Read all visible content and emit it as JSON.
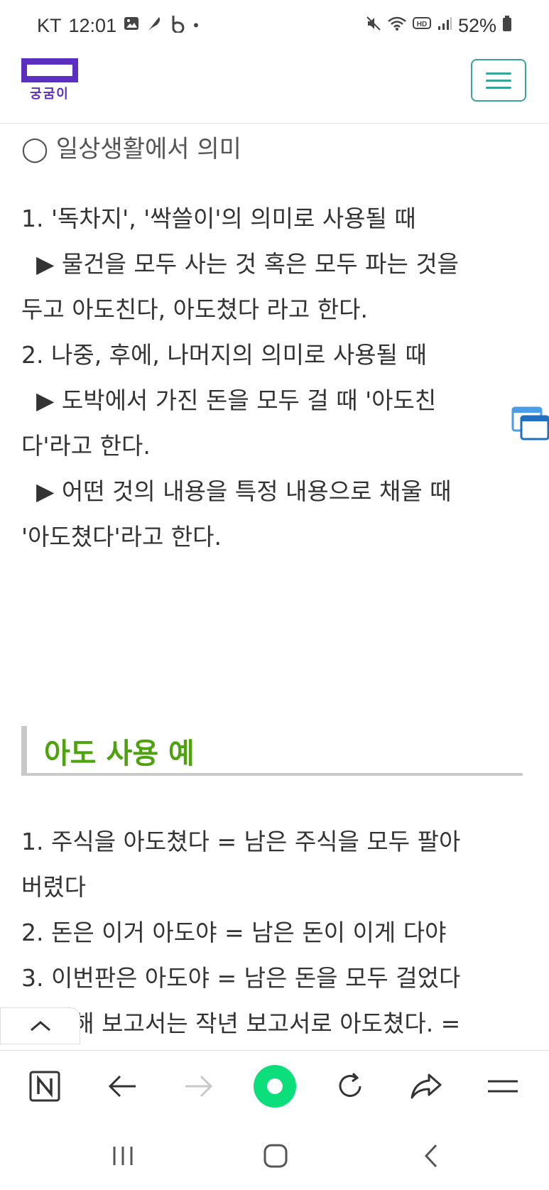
{
  "status_bar": {
    "carrier": "KT",
    "time": "12:01",
    "battery": "52%",
    "icons_left": [
      "gallery-icon",
      "feather-icon",
      "b-icon",
      "dot-icon"
    ],
    "icons_right": [
      "mute-icon",
      "wifi-icon",
      "hd-icon",
      "signal-icon",
      "battery-icon"
    ]
  },
  "header": {
    "logo_text": "궁굼이",
    "brand_color": "#5b2fc0",
    "menu_color": "#3aa39a"
  },
  "article": {
    "section_title": "◯ 일상생활에서 의미",
    "lines": [
      "1. '독차지', '싹쓸이'의 의미로 사용될 때",
      "  ▶ 물건을 모두 사는 것 혹은 모두 파는 것을",
      "두고 아도친다, 아도쳤다 라고 한다.",
      "2. 나중, 후에, 나머지의 의미로 사용될 때",
      "  ▶ 도박에서 가진 돈을 모두 걸 때 '아도친",
      "다'라고 한다.",
      "  ▶ 어떤 것의 내용을 특정 내용으로 채울 때",
      "'아도쳤다'라고 한다."
    ],
    "heading": "아도 사용 예",
    "heading_color": "#4ea20e",
    "example_lines": [
      "1. 주식을 아도쳤다 = 남은 주식을 모두 팔아",
      "버렸다",
      "2. 돈은 이거 아도야 = 남은 돈이 이게 다야",
      "3. 이번판은 아도야 = 남은 돈을 모두 걸었다",
      "4. 올해 보고서는 작년 보고서로 아도쳤다. ="
    ]
  },
  "toolbar": {
    "items": [
      "naver-icon",
      "back-arrow-icon",
      "forward-arrow-icon",
      "green-dot-icon",
      "refresh-icon",
      "share-icon",
      "menu-icon"
    ],
    "accent": "#0cde7c"
  },
  "navbar": {
    "items": [
      "recent-apps-icon",
      "home-icon",
      "back-icon"
    ]
  }
}
